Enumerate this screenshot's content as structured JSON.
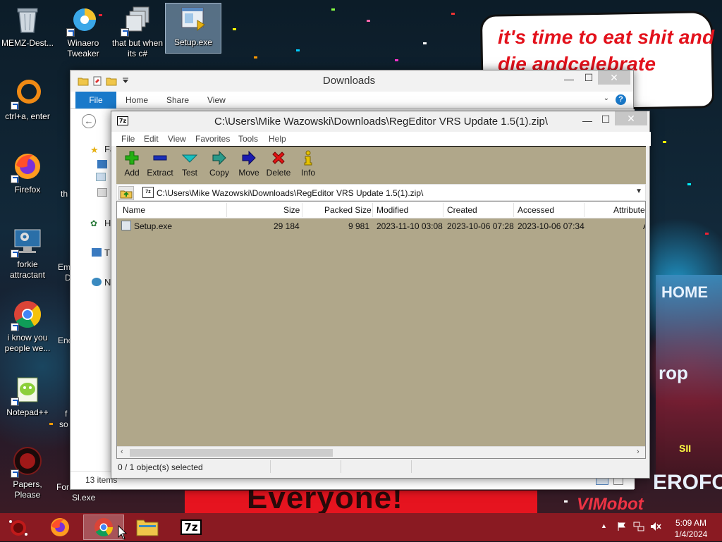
{
  "desktop": {
    "icons": [
      {
        "label1": "MEMZ-Dest...",
        "label2": ""
      },
      {
        "label1": "Winaero",
        "label2": "Tweaker"
      },
      {
        "label1": "that but when",
        "label2": "its c#"
      },
      {
        "label1": "Setup.exe",
        "label2": ""
      },
      {
        "label1": "ctrl+a, enter",
        "label2": ""
      },
      {
        "label1": "Firefox",
        "label2": ""
      },
      {
        "label1": "forkie",
        "label2": "attractant"
      },
      {
        "label1": "i know you",
        "label2": "people we..."
      },
      {
        "label1": "Notepad++",
        "label2": ""
      },
      {
        "label1": "Papers, Please",
        "label2": ""
      }
    ],
    "clipped_labels": [
      "th",
      "Em",
      "D",
      "Enc",
      "f",
      "so",
      "For",
      "Sl.exe"
    ],
    "wallpaper": {
      "bubble_text": "it's time to eat shit and die andcelebrate",
      "banner_text": "Everyone!",
      "right_texts": [
        "HOME",
        "rop",
        "EROFOS",
        "VIMobot",
        "SII"
      ]
    }
  },
  "explorer": {
    "title": "Downloads",
    "ribbon_tabs": [
      "File",
      "Home",
      "Share",
      "View"
    ],
    "help_label": "?",
    "sidebar_items": [
      "Fa",
      "H",
      "T",
      "N"
    ],
    "status": "13 items",
    "controls": {
      "minimize": "—",
      "maximize": "☐",
      "close": "✕"
    }
  },
  "sevenzip": {
    "title": "C:\\Users\\Mike Wazowski\\Downloads\\RegEditor VRS Update 1.5(1).zip\\",
    "app_icon": "7z",
    "menu": [
      "File",
      "Edit",
      "View",
      "Favorites",
      "Tools",
      "Help"
    ],
    "toolbar": [
      {
        "label": "Add",
        "icon": "plus-icon",
        "color": "#26b014"
      },
      {
        "label": "Extract",
        "icon": "minus-icon",
        "color": "#1a2fb8"
      },
      {
        "label": "Test",
        "icon": "check-icon",
        "color": "#19b0b0"
      },
      {
        "label": "Copy",
        "icon": "copy-arrow-icon",
        "color": "#2a8a7a"
      },
      {
        "label": "Move",
        "icon": "move-arrow-icon",
        "color": "#1a1ab0"
      },
      {
        "label": "Delete",
        "icon": "x-icon",
        "color": "#e01414"
      },
      {
        "label": "Info",
        "icon": "info-icon",
        "color": "#d8b400"
      }
    ],
    "address": "C:\\Users\\Mike Wazowski\\Downloads\\RegEditor VRS Update 1.5(1).zip\\",
    "columns": [
      "Name",
      "Size",
      "Packed Size",
      "Modified",
      "Created",
      "Accessed",
      "Attribute"
    ],
    "rows": [
      {
        "name": "Setup.exe",
        "size": "29 184",
        "packed": "9 981",
        "modified": "2023-11-10 03:08",
        "created": "2023-10-06 07:28",
        "accessed": "2023-10-06 07:34",
        "attr": "A"
      }
    ],
    "status": "0 / 1 object(s) selected",
    "list_bg": "#b0a78a",
    "controls": {
      "minimize": "—",
      "maximize": "☐",
      "close": "✕"
    }
  },
  "taskbar": {
    "apps": [
      "start-orb-icon",
      "firefox-icon",
      "chrome-icon",
      "file-explorer-icon",
      "7zip-icon"
    ],
    "active": "chrome-icon",
    "clock_time": "5:09 AM",
    "clock_date": "1/4/2024",
    "tray_icons": [
      "show-hidden-icon",
      "flag-icon",
      "network-icon",
      "volume-muted-icon"
    ],
    "tray_up": "▲",
    "zip_label": "7z",
    "color": "#8a1a22"
  }
}
